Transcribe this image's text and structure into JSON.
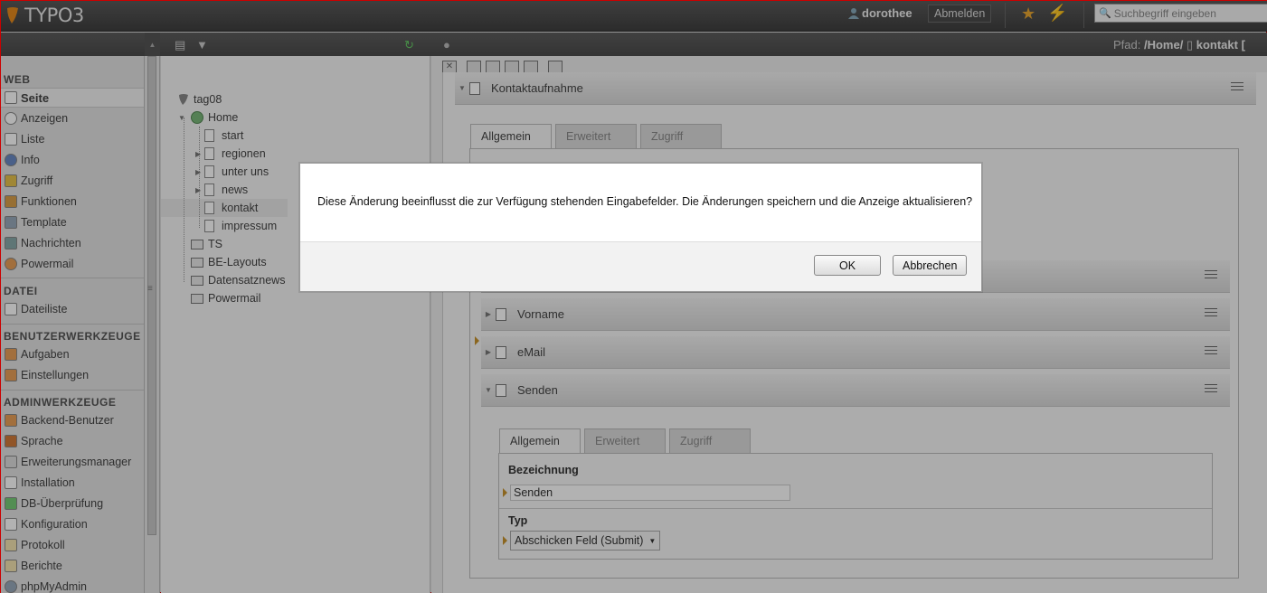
{
  "topbar": {
    "logo": "TYPO3",
    "user": "dorothee",
    "logout": "Abmelden",
    "search_placeholder": "Suchbegriff eingeben",
    "icons": [
      "bookmark-star-icon",
      "clear-cache-bolt-icon"
    ]
  },
  "path": {
    "label": "Pfad:",
    "value": "/Home/",
    "page": "kontakt ["
  },
  "modules": {
    "web": "WEB",
    "seite": "Seite",
    "anzeigen": "Anzeigen",
    "liste": "Liste",
    "info": "Info",
    "zugriff": "Zugriff",
    "funktionen": "Funktionen",
    "template": "Template",
    "nachrichten": "Nachrichten",
    "powermail": "Powermail",
    "datei": "DATEI",
    "dateiliste": "Dateiliste",
    "benutzer": "BENUTZERWERKZEUGE",
    "aufgaben": "Aufgaben",
    "einstellungen": "Einstellungen",
    "admin": "ADMINWERKZEUGE",
    "backend_benutzer": "Backend-Benutzer",
    "sprache": "Sprache",
    "erweiterungsmanager": "Erweiterungsmanager",
    "installation": "Installation",
    "db_pruefung": "DB-Überprüfung",
    "konfiguration": "Konfiguration",
    "protokoll": "Protokoll",
    "berichte": "Berichte",
    "phpmyadmin": "phpMyAdmin"
  },
  "tree": {
    "root": "tag08",
    "home": "Home",
    "start": "start",
    "regionen": "regionen",
    "unter_uns": "unter uns",
    "news": "news",
    "kontakt": "kontakt",
    "impressum": "impressum",
    "ts": "TS",
    "be_layouts": "BE-Layouts",
    "datensatznews": "Datensatznews",
    "powermail": "Powermail"
  },
  "content": {
    "record_title": "Kontaktaufnahme",
    "tabs": [
      "Allgemein",
      "Erweitert",
      "Zugriff"
    ],
    "fields": {
      "vorname": "Vorname",
      "email": "eMail",
      "senden": "Senden"
    },
    "senden_form": {
      "tabs": [
        "Allgemein",
        "Erweitert",
        "Zugriff"
      ],
      "bezeichnung_label": "Bezeichnung",
      "bezeichnung_value": "Senden",
      "typ_label": "Typ",
      "typ_value": "Abschicken Feld (Submit)"
    }
  },
  "dialog": {
    "message": "Diese Änderung beeinflusst die zur Verfügung stehenden Eingabefelder. Die Änderungen speichern und die Anzeige aktualisieren?",
    "ok": "OK",
    "cancel": "Abbrechen"
  },
  "colors": {
    "accent": "#c8922d",
    "topbar": "#4a4a4a",
    "overlay": "rgba(0,0,0,0.30)"
  }
}
